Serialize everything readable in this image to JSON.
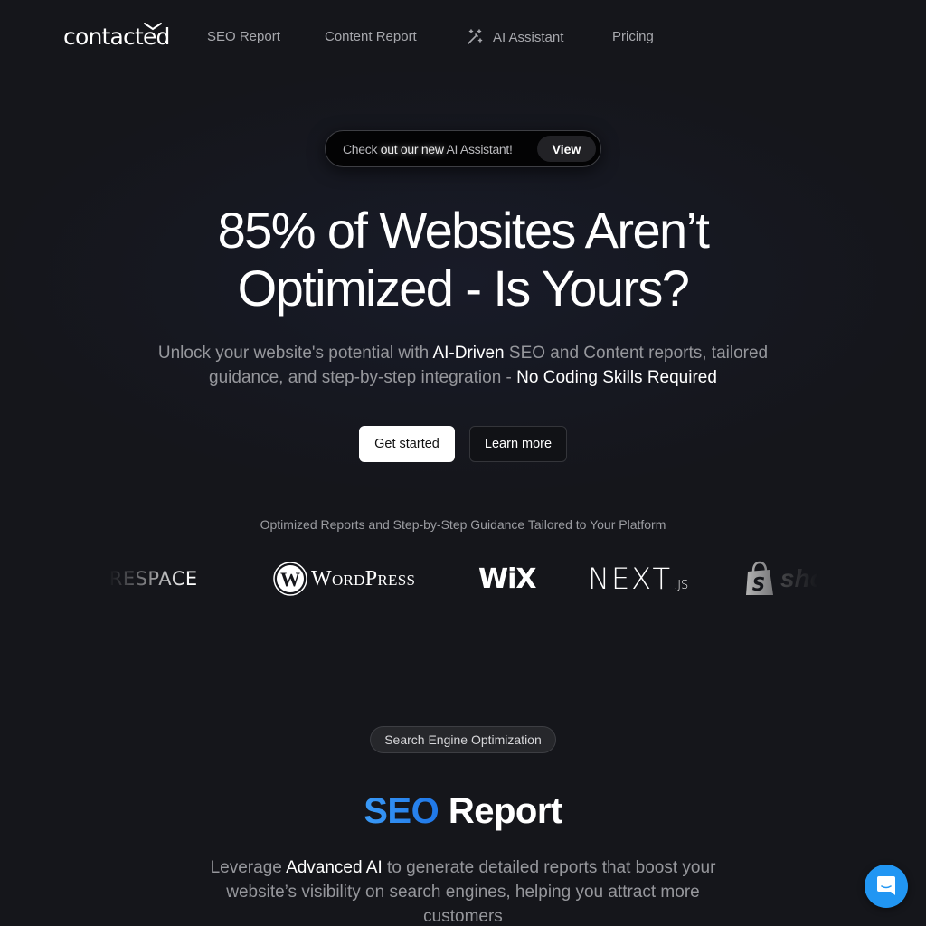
{
  "nav": {
    "logo": "contacted",
    "links": [
      {
        "label": "SEO Report"
      },
      {
        "label": "Content Report"
      },
      {
        "label": "AI Assistant",
        "icon": "magic-wand-icon"
      },
      {
        "label": "Pricing"
      }
    ]
  },
  "announcement": {
    "text_before": "Check ",
    "text_glow": "out our new",
    "text_after": " AI Assistant!",
    "button_label": "View"
  },
  "hero": {
    "headline_line1": "85% of Websites Aren’t",
    "headline_line2": "Optimized - Is Yours?",
    "sub_part1": "Unlock your website's potential with ",
    "sub_hl1": "AI-Driven",
    "sub_part2": " SEO and Content reports, tailored guidance, and step-by-step integration - ",
    "sub_hl2": "No Coding Skills Required",
    "primary_button": "Get started",
    "secondary_button": "Learn more"
  },
  "platforms": {
    "caption": "Optimized Reports and Step-by-Step Guidance Tailored to Your Platform",
    "logos": [
      {
        "name": "Squarespace",
        "visible_text": "UARESPACE"
      },
      {
        "name": "WordPress",
        "visible_text": "WordPress"
      },
      {
        "name": "Wix",
        "visible_text": "WiX"
      },
      {
        "name": "Next.js",
        "visible_text": "NEXT",
        "suffix": ".JS"
      },
      {
        "name": "Shopify",
        "visible_text": "sho"
      }
    ]
  },
  "seo_section": {
    "badge": "Search Engine Optimization",
    "title_accent": "SEO",
    "title_rest": " Report",
    "desc_part1": "Leverage ",
    "desc_hl": "Advanced AI",
    "desc_part2": " to generate detailed reports that boost your website’s visibility on search engines, helping you attract more customers"
  },
  "colors": {
    "background": "#15161b",
    "accent_blue": "#2f8ef5",
    "chat_button": "#2196f3",
    "muted_text": "#96979c"
  },
  "chat_widget": {
    "icon": "chat-bubble-icon"
  }
}
